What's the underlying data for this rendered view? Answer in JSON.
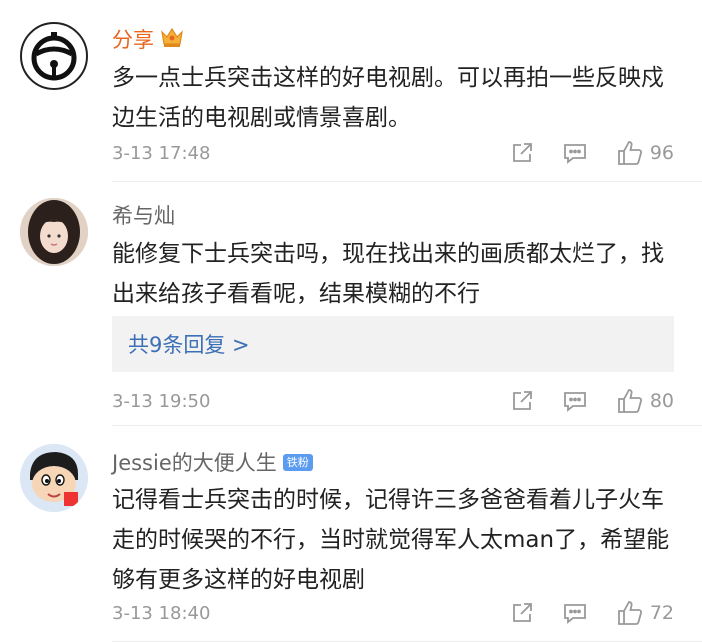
{
  "comments": [
    {
      "username": "分享",
      "badge_icon": "crown-icon",
      "text": "多一点士兵突击这样的好电视剧。可以再拍一些反映戍边生活的电视剧或情景喜剧。",
      "time": "3-13 17:48",
      "likes": "96"
    },
    {
      "username": "希与灿",
      "text": "能修复下士兵突击吗，现在找出来的画质都太烂了，找出来给孩子看看呢，结果模糊的不行",
      "reply_link": "共9条回复 >",
      "time": "3-13 19:50",
      "likes": "80"
    },
    {
      "username": "Jessie的大便人生",
      "badge_text": "铁粉",
      "text": "记得看士兵突击的时候，记得许三多爸爸看着儿子火车走的时候哭的不行，当时就觉得军人太man了，希望能够有更多这样的好电视剧",
      "time": "3-13 18:40",
      "likes": "72"
    }
  ],
  "colors": {
    "username_highlight": "#e8661d",
    "link": "#3b6fb6",
    "meta": "#999999"
  }
}
